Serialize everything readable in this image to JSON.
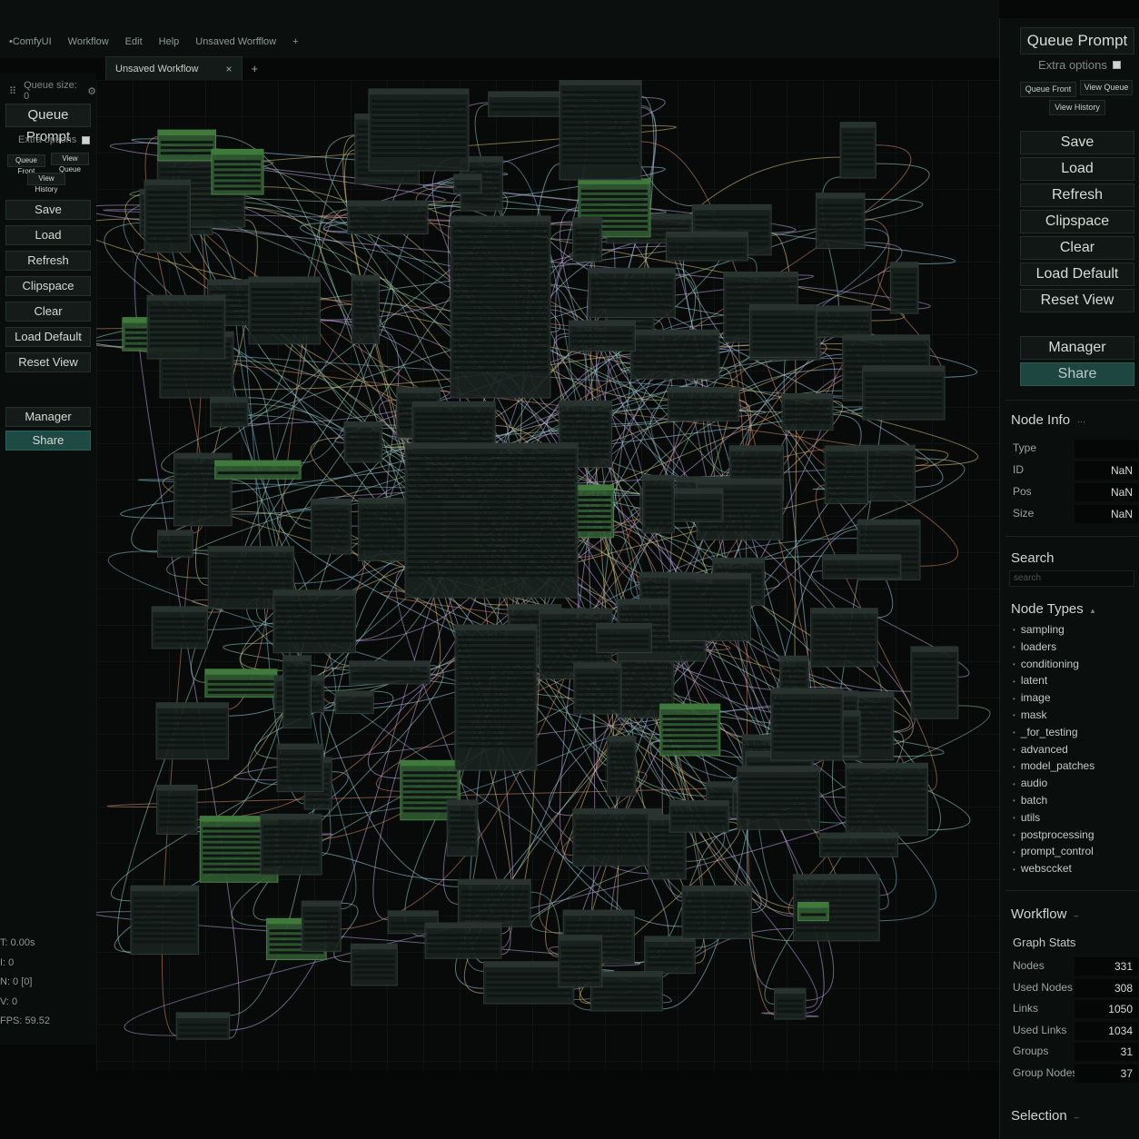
{
  "menu": {
    "app": "•ComfyUI",
    "items": [
      "Workflow",
      "Edit",
      "Help"
    ],
    "top_tab": "Unsaved Worfflow"
  },
  "tab": {
    "title": "Unsaved Workflow",
    "close": "×",
    "add": "+"
  },
  "left": {
    "queue_size": "Queue size: 0",
    "queue_prompt": "Queue Prompt",
    "extra_options": "Extra options",
    "queue_front": "Queue Front",
    "view_queue": "View Queue",
    "view_history": "View History",
    "buttons": [
      "Save",
      "Load",
      "Refresh",
      "Clipspace",
      "Clear",
      "Load Default",
      "Reset View"
    ],
    "manager": "Manager",
    "share": "Share",
    "stats": [
      "T: 0.00s",
      "I: 0",
      "N: 0 [0]",
      "V: 0",
      "FPS: 59.52"
    ]
  },
  "right": {
    "queue_prompt": "Queue Prompt",
    "extra_options": "Extra options",
    "queue_front": "Queue Front",
    "view_queue": "View Queue",
    "view_history": "View History",
    "buttons": [
      "Save",
      "Load",
      "Refresh",
      "Clipspace",
      "Clear",
      "Load Default",
      "Reset View"
    ],
    "manager": "Manager",
    "share": "Share",
    "node_info": {
      "title": "Node Info",
      "rows": [
        {
          "label": "Type",
          "value": ""
        },
        {
          "label": "ID",
          "value": "NaN"
        },
        {
          "label": "Pos",
          "value": "NaN"
        },
        {
          "label": "Size",
          "value": "NaN"
        }
      ]
    },
    "search": {
      "title": "Search",
      "placeholder": "search"
    },
    "node_types": {
      "title": "Node Types",
      "items": [
        "sampling",
        "loaders",
        "conditioning",
        "latent",
        "image",
        "mask",
        "_for_testing",
        "advanced",
        "model_patches",
        "audio",
        "batch",
        "utils",
        "postprocessing",
        "prompt_control",
        "websccket"
      ]
    },
    "workflow": {
      "title": "Workflow",
      "graph_stats": "Graph Stats",
      "rows": [
        {
          "label": "Nodes",
          "value": "331"
        },
        {
          "label": "Used Nodes",
          "value": "308"
        },
        {
          "label": "Links",
          "value": "1050"
        },
        {
          "label": "Used Links",
          "value": "1034"
        },
        {
          "label": "Groups",
          "value": "31"
        },
        {
          "label": "Group Nodes",
          "value": "37"
        }
      ]
    },
    "selection": {
      "title": "Selection"
    }
  },
  "colors": {
    "accent_share": "#1f4a43",
    "node_green": "#2f5a30",
    "node_dark": "#1a2320"
  }
}
